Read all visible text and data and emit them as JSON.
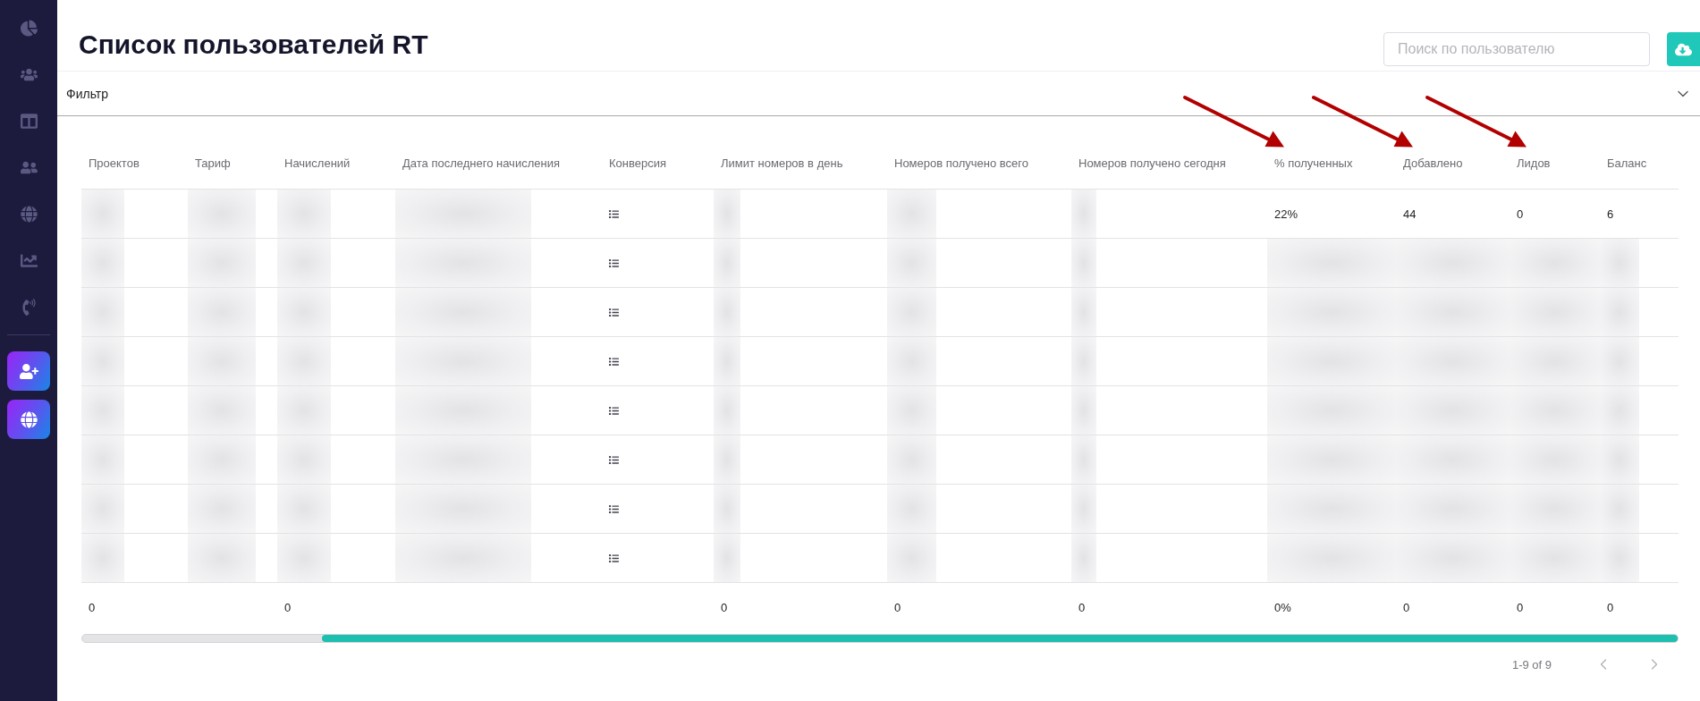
{
  "sidebar": {
    "items": [
      {
        "selected": false
      },
      {
        "selected": false
      },
      {
        "selected": false
      },
      {
        "selected": false
      },
      {
        "selected": false
      },
      {
        "selected": false
      },
      {
        "selected": false
      }
    ]
  },
  "header": {
    "title": "Список пользователей RT",
    "search": {
      "placeholder": "Поиск по пользователю"
    }
  },
  "filter": {
    "label": "Фильтр",
    "expanded": false
  },
  "table": {
    "columns": [
      {
        "label": "Проектов",
        "marked": false
      },
      {
        "label": "Тариф",
        "marked": false
      },
      {
        "label": "Начислений",
        "marked": false
      },
      {
        "label": "Дата последнего начисления",
        "marked": false
      },
      {
        "label": "Конверсия",
        "marked": false
      },
      {
        "label": "Лимит номеров в день",
        "marked": false
      },
      {
        "label": "Номеров получено всего",
        "marked": false
      },
      {
        "label": "Номеров получено сегодня",
        "marked": false
      },
      {
        "label": "% полученных",
        "marked": true
      },
      {
        "label": "Добавлено",
        "marked": true
      },
      {
        "label": "Лидов",
        "marked": true
      },
      {
        "label": "Баланс",
        "marked": false
      }
    ],
    "rows": [
      {
        "cells": [
          {
            "kind": "blurred"
          },
          {
            "kind": "blurred"
          },
          {
            "kind": "blurred"
          },
          {
            "kind": "blurred"
          },
          {
            "kind": "list"
          },
          {
            "kind": "blurred"
          },
          {
            "kind": "blurred"
          },
          {
            "kind": "blurred"
          },
          {
            "kind": "text",
            "text": "22%"
          },
          {
            "kind": "text",
            "text": "44"
          },
          {
            "kind": "text",
            "text": "0"
          },
          {
            "kind": "text",
            "text": "6"
          }
        ]
      },
      {
        "cells": [
          {
            "kind": "blurred"
          },
          {
            "kind": "blurred"
          },
          {
            "kind": "blurred"
          },
          {
            "kind": "blurred"
          },
          {
            "kind": "list"
          },
          {
            "kind": "blurred"
          },
          {
            "kind": "blurred"
          },
          {
            "kind": "blurred"
          },
          {
            "kind": "blurred"
          },
          {
            "kind": "blurred"
          },
          {
            "kind": "blurred"
          },
          {
            "kind": "blurred"
          }
        ]
      },
      {
        "cells": [
          {
            "kind": "blurred"
          },
          {
            "kind": "blurred"
          },
          {
            "kind": "blurred"
          },
          {
            "kind": "blurred"
          },
          {
            "kind": "list"
          },
          {
            "kind": "blurred"
          },
          {
            "kind": "blurred"
          },
          {
            "kind": "blurred"
          },
          {
            "kind": "blurred"
          },
          {
            "kind": "blurred"
          },
          {
            "kind": "blurred"
          },
          {
            "kind": "blurred"
          }
        ]
      },
      {
        "cells": [
          {
            "kind": "blurred"
          },
          {
            "kind": "blurred"
          },
          {
            "kind": "blurred"
          },
          {
            "kind": "blurred"
          },
          {
            "kind": "list"
          },
          {
            "kind": "blurred"
          },
          {
            "kind": "blurred"
          },
          {
            "kind": "blurred"
          },
          {
            "kind": "blurred"
          },
          {
            "kind": "blurred"
          },
          {
            "kind": "blurred"
          },
          {
            "kind": "blurred"
          }
        ]
      },
      {
        "cells": [
          {
            "kind": "blurred"
          },
          {
            "kind": "blurred"
          },
          {
            "kind": "blurred"
          },
          {
            "kind": "blurred"
          },
          {
            "kind": "list"
          },
          {
            "kind": "blurred"
          },
          {
            "kind": "blurred"
          },
          {
            "kind": "blurred"
          },
          {
            "kind": "blurred"
          },
          {
            "kind": "blurred"
          },
          {
            "kind": "blurred"
          },
          {
            "kind": "blurred"
          }
        ]
      },
      {
        "cells": [
          {
            "kind": "blurred"
          },
          {
            "kind": "blurred"
          },
          {
            "kind": "blurred"
          },
          {
            "kind": "blurred"
          },
          {
            "kind": "list"
          },
          {
            "kind": "blurred"
          },
          {
            "kind": "blurred"
          },
          {
            "kind": "blurred"
          },
          {
            "kind": "blurred"
          },
          {
            "kind": "blurred"
          },
          {
            "kind": "blurred"
          },
          {
            "kind": "blurred"
          }
        ]
      },
      {
        "cells": [
          {
            "kind": "blurred"
          },
          {
            "kind": "blurred"
          },
          {
            "kind": "blurred"
          },
          {
            "kind": "blurred"
          },
          {
            "kind": "list"
          },
          {
            "kind": "blurred"
          },
          {
            "kind": "blurred"
          },
          {
            "kind": "blurred"
          },
          {
            "kind": "blurred"
          },
          {
            "kind": "blurred"
          },
          {
            "kind": "blurred"
          },
          {
            "kind": "blurred"
          }
        ]
      },
      {
        "cells": [
          {
            "kind": "blurred"
          },
          {
            "kind": "blurred"
          },
          {
            "kind": "blurred"
          },
          {
            "kind": "blurred"
          },
          {
            "kind": "list"
          },
          {
            "kind": "blurred"
          },
          {
            "kind": "blurred"
          },
          {
            "kind": "blurred"
          },
          {
            "kind": "blurred"
          },
          {
            "kind": "blurred"
          },
          {
            "kind": "blurred"
          },
          {
            "kind": "blurred"
          }
        ]
      }
    ],
    "totals": {
      "cells": [
        {
          "kind": "text",
          "text": "0"
        },
        {
          "kind": "empty"
        },
        {
          "kind": "text",
          "text": "0"
        },
        {
          "kind": "empty"
        },
        {
          "kind": "empty"
        },
        {
          "kind": "text",
          "text": "0"
        },
        {
          "kind": "text",
          "text": "0"
        },
        {
          "kind": "text",
          "text": "0"
        },
        {
          "kind": "text",
          "text": "0%"
        },
        {
          "kind": "text",
          "text": "0"
        },
        {
          "kind": "text",
          "text": "0"
        },
        {
          "kind": "text",
          "text": "0"
        }
      ]
    }
  },
  "pagination": {
    "range": "1-9 of 9",
    "prev": {
      "disabled": true
    },
    "next": {
      "disabled": true
    }
  }
}
